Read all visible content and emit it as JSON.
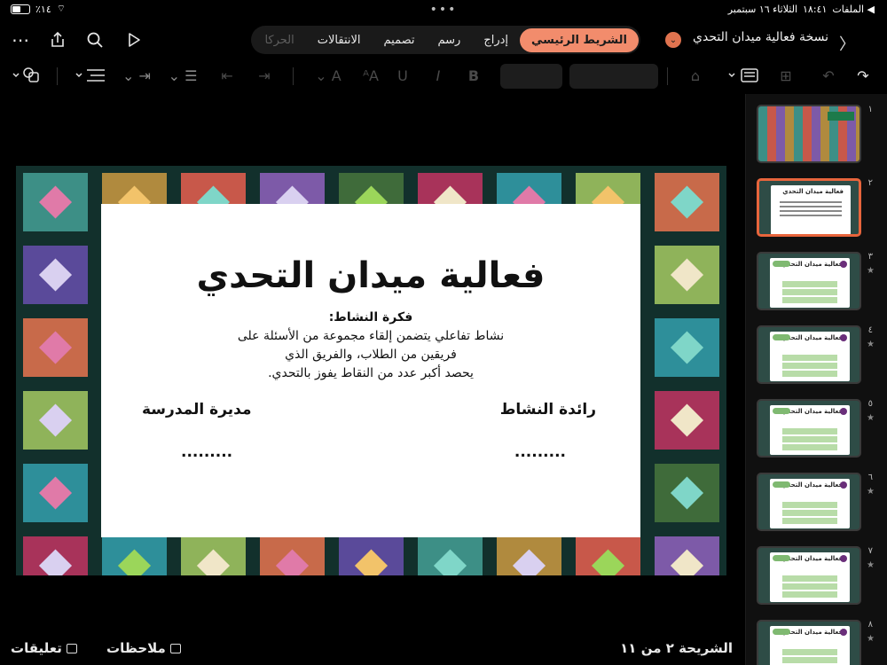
{
  "status": {
    "back_label": "◀ الملفات",
    "time": "١٨:٤١",
    "date": "الثلاثاء ١٦ سبتمبر",
    "battery": "٪١٤"
  },
  "title_bar": {
    "doc_title": "نسخة  فعالية ميدان التحدي"
  },
  "tabs": [
    {
      "label": "الشريط الرئيسي",
      "active": true
    },
    {
      "label": "إدراج"
    },
    {
      "label": "رسم"
    },
    {
      "label": "تصميم"
    },
    {
      "label": "الانتقالات"
    },
    {
      "label": "الحركا"
    }
  ],
  "slide": {
    "title": "فعالية ميدان التحدي",
    "subtitle": "فكرة النشاط:",
    "lines": [
      "نشاط تفاعلي يتضمن إلقاء مجموعة من الأسئلة على",
      "فريقين من الطلاب، والفريق الذي",
      "يحصد أكبر عدد من النقاط يفوز بالتحدي."
    ],
    "sig_right_title": "رائدة النشاط",
    "sig_left_title": "مديرة المدرسة",
    "sig_right_dots": ".........",
    "sig_left_dots": "........."
  },
  "bottom": {
    "slide_counter": "الشريحة ٢ من ١١",
    "notes_label": "ملاحظات",
    "comments_label": "تعليقات"
  },
  "thumbnails": {
    "numbers": [
      "١",
      "٢",
      "٣",
      "٤",
      "٥",
      "٦",
      "٧",
      "٨"
    ],
    "selected": 2,
    "mini_title": "فعالية ميدان التحدي"
  },
  "colors": {
    "accent": "#f28c6c",
    "selection_border": "#e8653c",
    "slide_bg": "#1f3f3a"
  }
}
